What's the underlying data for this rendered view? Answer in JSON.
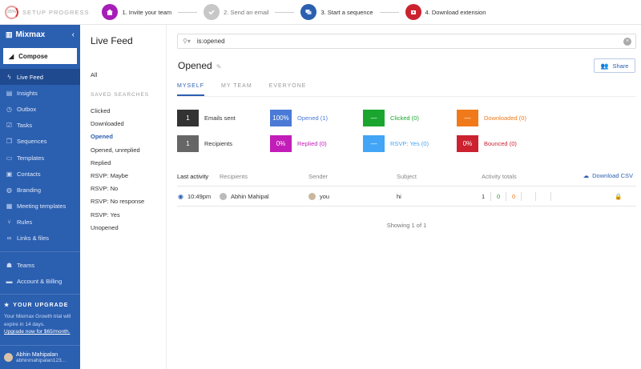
{
  "progress": {
    "percent": "25%",
    "label": "SETUP PROGRESS",
    "steps": [
      {
        "label": "1. Invite your team",
        "color": "#a61db8",
        "icon": "house-icon"
      },
      {
        "label": "2. Send an email",
        "color": "#c7c7c7",
        "icon": "check-icon"
      },
      {
        "label": "3. Start a sequence",
        "color": "#2b5fb0",
        "icon": "sequence-icon"
      },
      {
        "label": "4. Download extension",
        "color": "#cc2230",
        "icon": "download-box-icon"
      }
    ]
  },
  "sidebar": {
    "brand": "Mixmax",
    "compose": "Compose",
    "items": [
      {
        "label": "Live Feed",
        "icon": "bolt-icon"
      },
      {
        "label": "Insights",
        "icon": "bar-chart-icon"
      },
      {
        "label": "Outbox",
        "icon": "clock-icon"
      },
      {
        "label": "Tasks",
        "icon": "checkbox-icon"
      },
      {
        "label": "Sequences",
        "icon": "sequence-icon"
      },
      {
        "label": "Templates",
        "icon": "document-icon"
      },
      {
        "label": "Contacts",
        "icon": "contact-icon"
      },
      {
        "label": "Branding",
        "icon": "globe-icon"
      },
      {
        "label": "Meeting templates",
        "icon": "calendar-icon"
      },
      {
        "label": "Rules",
        "icon": "rules-icon"
      },
      {
        "label": "Links & files",
        "icon": "link-icon"
      }
    ],
    "items2": [
      {
        "label": "Teams",
        "icon": "team-icon"
      },
      {
        "label": "Account & Billing",
        "icon": "card-icon"
      }
    ],
    "upgrade": {
      "title": "YOUR UPGRADE",
      "text": "Your Mixmax Growth trial will expire in 14 days.",
      "link": "Upgrade now for $65/month."
    },
    "user": {
      "name": "Abhin Mahipalan",
      "email": "abhinmahipalan123..."
    }
  },
  "searches": {
    "title": "Live Feed",
    "all": "All",
    "section": "SAVED SEARCHES",
    "items": [
      "Clicked",
      "Downloaded",
      "Opened",
      "Opened, unreplied",
      "Replied",
      "RSVP: Maybe",
      "RSVP: No",
      "RSVP: No response",
      "RSVP: Yes",
      "Unopened"
    ]
  },
  "main": {
    "search_value": "is:opened",
    "title": "Opened",
    "share": "Share",
    "tabs": [
      "MYSELF",
      "MY TEAM",
      "EVERYONE"
    ],
    "stats": {
      "emails_sent": {
        "value": "1",
        "label": "Emails sent",
        "color": "#333333"
      },
      "recipients": {
        "value": "1",
        "label": "Recipients",
        "color": "#666666"
      },
      "opened": {
        "value": "100%",
        "label": "Opened (1)",
        "color": "#4a7ad6"
      },
      "replied": {
        "value": "0%",
        "label": "Replied (0)",
        "color": "#c21db8"
      },
      "clicked": {
        "value": "—",
        "label": "Clicked (0)",
        "color": "#1aa62e"
      },
      "rsvp": {
        "value": "—",
        "label": "RSVP: Yes (0)",
        "color": "#42a5f5"
      },
      "downloaded": {
        "value": "—",
        "label": "Downloaded (0)",
        "color": "#f07a1a"
      },
      "bounced": {
        "value": "0%",
        "label": "Bounced (0)",
        "color": "#cc2230"
      }
    },
    "table": {
      "headers": [
        "Last activity",
        "Recipients",
        "Sender",
        "Subject",
        "Activity totals"
      ],
      "download": "Download CSV",
      "row": {
        "time": "10:49pm",
        "recipient": "Abhin Mahipal",
        "sender": "you",
        "subject": "hi",
        "c1": "1",
        "c2": "0",
        "c3": "0"
      }
    },
    "showing": "Showing 1 of 1"
  }
}
